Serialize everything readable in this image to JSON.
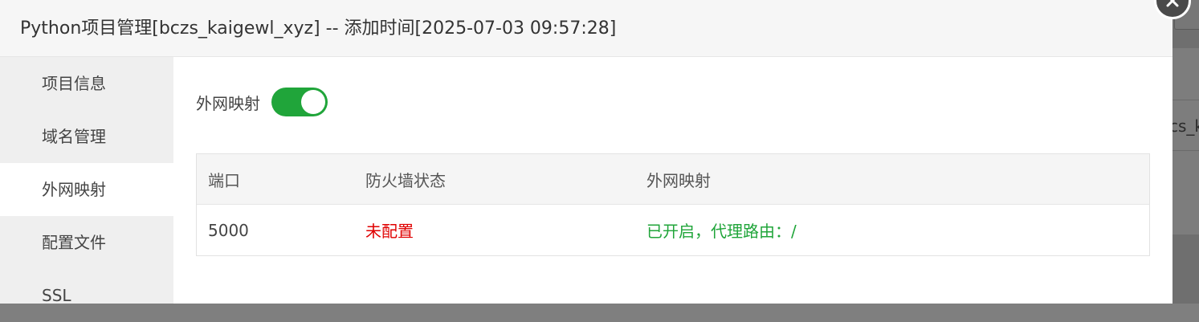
{
  "dialog": {
    "title": "Python项目管理[bczs_kaigewl_xyz] -- 添加时间[2025-07-03 09:57:28]"
  },
  "close_icon": "close-icon",
  "sidebar": {
    "items": [
      {
        "label": "项目信息",
        "active": false
      },
      {
        "label": "域名管理",
        "active": false
      },
      {
        "label": "外网映射",
        "active": true
      },
      {
        "label": "配置文件",
        "active": false
      },
      {
        "label": "SSL",
        "active": false
      }
    ]
  },
  "main": {
    "toggle_label": "外网映射",
    "toggle_on": true,
    "table": {
      "headers": [
        "端口",
        "防火墙状态",
        "外网映射"
      ],
      "rows": [
        {
          "port": "5000",
          "firewall": "未配置",
          "mapping": "已开启，代理路由：/"
        }
      ]
    }
  },
  "background": {
    "partial_text": "cs_k"
  },
  "colors": {
    "accent_green": "#20a53a",
    "warning_red": "#e00000"
  }
}
